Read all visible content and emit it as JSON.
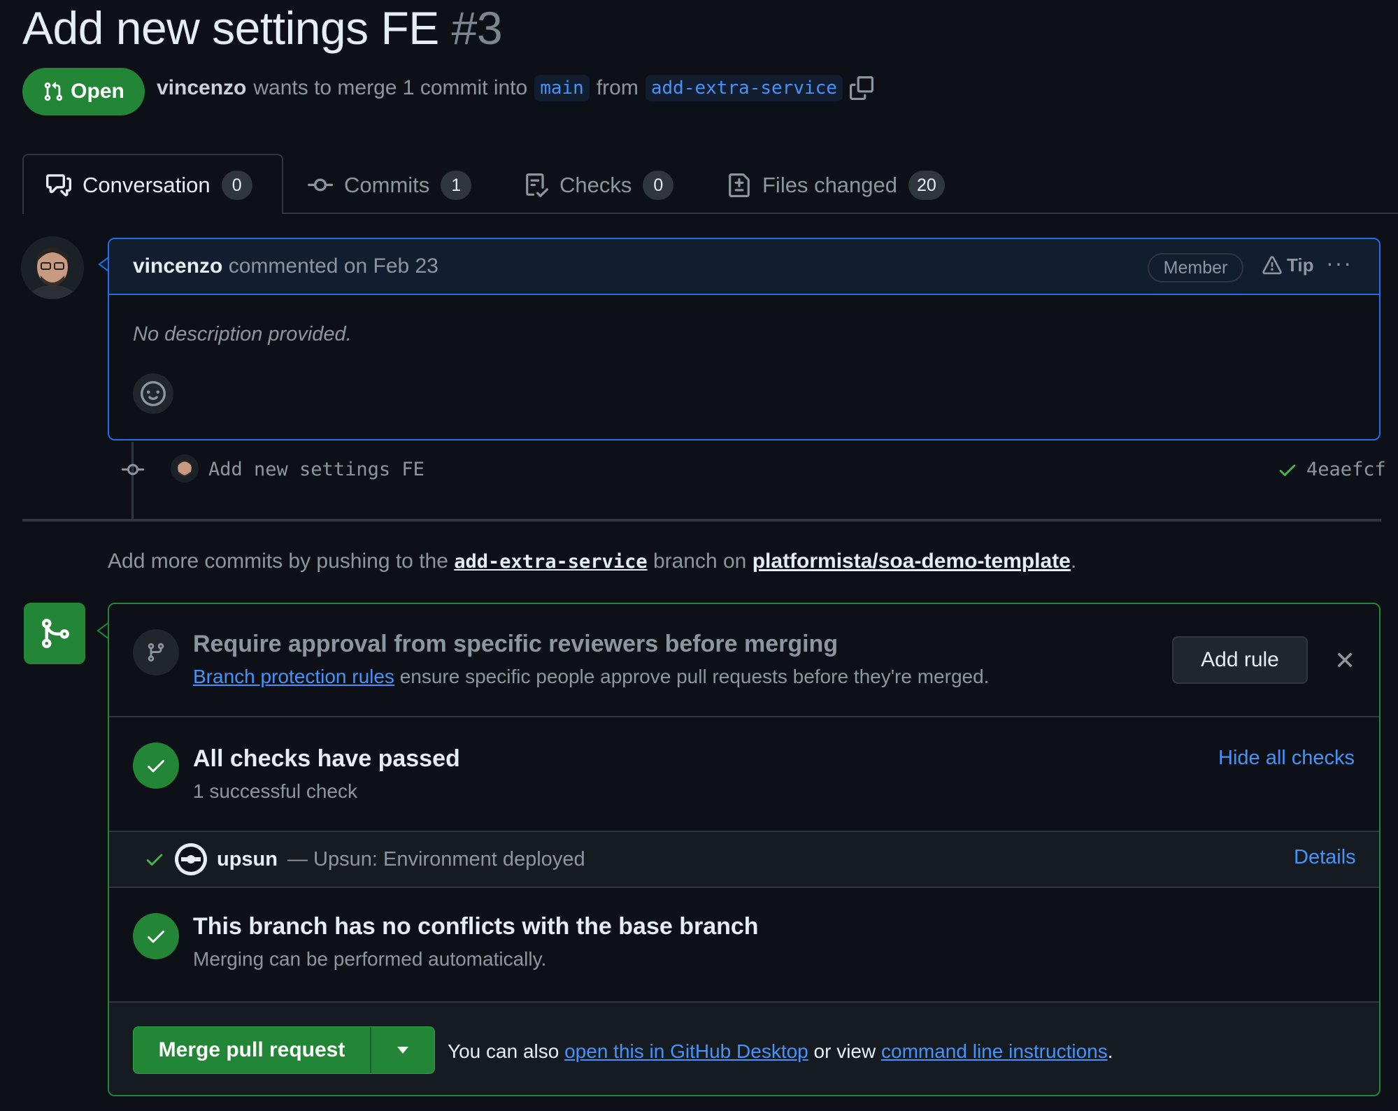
{
  "pr": {
    "title": "Add new settings FE",
    "number": "#3",
    "state": "Open",
    "author": "vincenzo",
    "merge_text": "wants to merge 1 commit into",
    "base_branch": "main",
    "from_text": "from",
    "head_branch": "add-extra-service"
  },
  "tabs": [
    {
      "label": "Conversation",
      "count": "0"
    },
    {
      "label": "Commits",
      "count": "1"
    },
    {
      "label": "Checks",
      "count": "0"
    },
    {
      "label": "Files changed",
      "count": "20"
    }
  ],
  "comment": {
    "author": "vincenzo",
    "action": "commented on Feb 23",
    "badge": "Member",
    "tip": "Tip",
    "body": "No description provided."
  },
  "commit": {
    "message": "Add new settings FE",
    "sha": "4eaefcf"
  },
  "hint": {
    "prefix": "Add more commits by pushing to the",
    "branch": "add-extra-service",
    "middle": "branch on",
    "repo": "platformista/soa-demo-template",
    "suffix": "."
  },
  "merge": {
    "rule_title": "Require approval from specific reviewers before merging",
    "rule_link": "Branch protection rules",
    "rule_text": "ensure specific people approve pull requests before they're merged.",
    "add_rule": "Add rule",
    "checks_title": "All checks have passed",
    "checks_sub": "1 successful check",
    "hide_checks": "Hide all checks",
    "check_name": "upsun",
    "check_desc": "— Upsun: Environment deployed",
    "details": "Details",
    "conflict_title": "This branch has no conflicts with the base branch",
    "conflict_sub": "Merging can be performed automatically.",
    "merge_button": "Merge pull request",
    "also_prefix": "You can also",
    "desktop_link": "open this in GitHub Desktop",
    "also_middle": "or view",
    "cli_link": "command line instructions",
    "also_suffix": "."
  },
  "colors": {
    "background": "#0d1117",
    "accent_green": "#238636",
    "link_blue": "#4493f8",
    "border": "#30363d"
  }
}
